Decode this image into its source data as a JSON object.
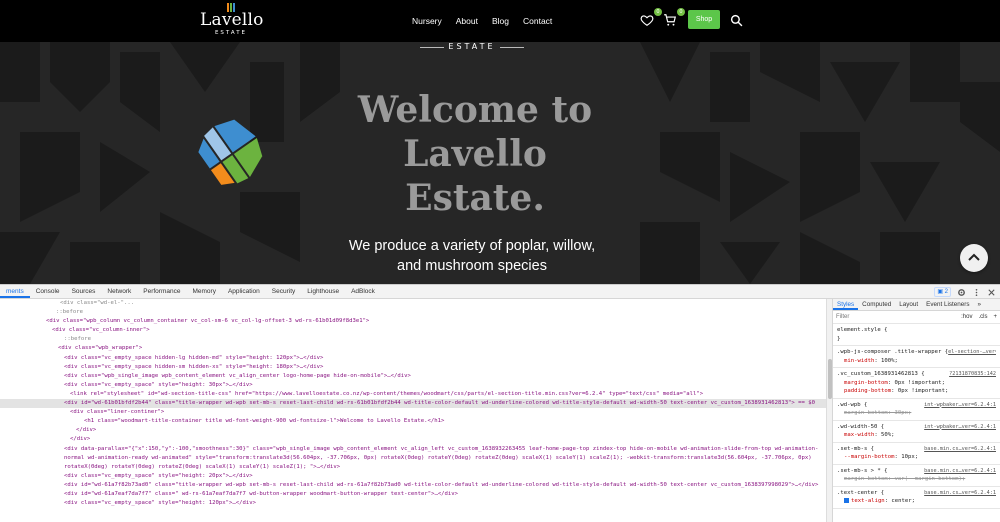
{
  "site": {
    "logo": {
      "name": "Lavello",
      "sub": "ESTATE"
    },
    "nav": [
      "Nursery",
      "About",
      "Blog",
      "Contact"
    ],
    "wishlist_count": "0",
    "cart_count": "0",
    "shop_label": "Shop",
    "estate_banner": "ESTATE",
    "hero_title": "Welcome to Lavello Estate.",
    "hero_subtitle": "We produce a variety of poplar, willow, and mushroom species",
    "colors": {
      "accent": "#5cc64a",
      "hero_title": "#9a9a9a",
      "background": "#262626"
    }
  },
  "devtools": {
    "tabs": [
      "ments",
      "Console",
      "Sources",
      "Network",
      "Performance",
      "Memory",
      "Application",
      "Security",
      "Lighthouse",
      "AdBlock"
    ],
    "active_tab": "ments",
    "issues_badge": "2",
    "elements": {
      "l0": "<div class=\"wd-el-\"...",
      "l1": "::before",
      "l2a": "<div class=\"wpb_column vc_column_container vc_col-sm-6 vc_col-lg-offset-3 wd-rs-61b01d09f8d3e1\">",
      "l3": "<div class=\"vc_column-inner\">",
      "l4": "::before",
      "l5": "<div class=\"wpb_wrapper\">",
      "l6": "<div class=\"vc_empty_space hidden-lg hidden-md\" style=\"height: 120px\">…</div>",
      "l7": "<div class=\"vc_empty_space hidden-sm hidden-xs\" style=\"height: 180px\">…</div>",
      "l8": "<div class=\"wpb_single_image wpb_content_element vc_align_center logo-home-page hide-on-mobile\">…</div>",
      "l9": "<div class=\"vc_empty_space\" style=\"height: 30px\">…</div>",
      "l10": "<link rel=\"stylesheet\" id=\"wd-section-title-css\" href=\"https://www.lavelloestate.co.nz/wp-content/themes/woodmart/css/parts/el-section-title.min.css?ver=6.2.4\" type=\"text/css\" media=\"all\">",
      "l11": "<div id=\"wd-61b01bfdf2b44\" class=\"title-wrapper wd-wpb set-mb-s reset-last-child  wd-rs-61b01bfdf2b44 wd-title-color-default wd-underline-colored wd-title-style-default wd-width-50 text-center vc_custom_1638931462813\"> == $0",
      "l12": "<div class=\"liner-continer\">",
      "l13": "<h1 class=\"woodmart-title-container title  wd-font-weight-900 wd-fontsize-l\">Welcome to Lavello Estate.</h1>",
      "l14": "</div>",
      "l15": "</div>",
      "l16": "<div data-parallax=\"{\"x\":150,\"y\":-100,\"smoothness\":30}\" class=\"wpb_single_image wpb_content_element vc_align_left vc_custom_1638932263455 leaf-home-page-top zindex-top hide-on-mobile wd-animation-slide-from-top wd-animation-normal wd-animation-ready wd-animated\" style=\"transform:translate3d(56.604px, -37.706px, 0px) rotateX(0deg) rotateY(0deg) rotateZ(0deg) scaleX(1) scaleY(1) scaleZ(1); -webkit-transform:translate3d(56.604px, -37.706px, 0px) rotateX(0deg) rotateY(0deg) rotateZ(0deg) scaleX(1) scaleY(1) scaleZ(1); \">…</div>",
      "l17": "<div class=\"vc_empty_space\" style=\"height: 20px\">…</div>",
      "l18": "<div id=\"wd-61a7f82b73ad0\" class=\"title-wrapper wd-wpb set-mb-s reset-last-child  wd-rs-61a7f82b73ad0 wd-title-color-default wd-underline-colored wd-title-style-default wd-width-50 text-center vc_custom_1638397998029\">…</div>",
      "l19": "<div id=\"wd-61a7eaf7da7f7\" class=\"  wd-rs-61a7eaf7da7f7 wd-button-wrapper woodmart-button-wrapper text-center\">…</div>",
      "l20": "<div class=\"vc_empty_space\" style=\"height: 120px\">…</div>"
    },
    "styles": {
      "tabs": [
        "Styles",
        "Computed",
        "Layout",
        "Event Listeners",
        "»"
      ],
      "filter_placeholder": "Filter",
      "hov": ":hov",
      "cls": ".cls",
      "plus": "+",
      "rules": [
        {
          "selector": "element.style {",
          "source": "",
          "props": []
        },
        {
          "selector": ".wpb-js-composer .title-wrapper {",
          "source": "el-section-…ver=6.2.4:1",
          "props": [
            {
              "n": "min-width",
              "v": "100%;",
              "strike": false
            }
          ]
        },
        {
          "selector": ".vc_custom_1638931462813 {",
          "source": "?2131870835:142",
          "props": [
            {
              "n": "margin-bottom",
              "v": "0px !important;",
              "strike": false
            },
            {
              "n": "padding-bottom",
              "v": "0px !important;",
              "strike": false
            }
          ]
        },
        {
          "selector": ".wd-wpb {",
          "source": "int-wpbaker…ver=6.2.4:1",
          "props": [
            {
              "n": "margin-bottom",
              "v": "30px;",
              "strike": true
            }
          ]
        },
        {
          "selector": ".wd-width-50 {",
          "source": "int-wpbaker…ver=6.2.4:1",
          "props": [
            {
              "n": "max-width",
              "v": "50%;",
              "strike": false
            }
          ]
        },
        {
          "selector": ".set-mb-s {",
          "source": "base.min.cs…ver=6.2.4:1",
          "props": [
            {
              "n": "--margin-bottom",
              "v": "10px;",
              "strike": false
            }
          ]
        },
        {
          "selector": ".set-mb-s > * {",
          "source": "base.min.cs…ver=6.2.4:1",
          "props": [
            {
              "n": "margin-bottom",
              "v": "var(--margin-bottom);",
              "strike": true
            }
          ]
        },
        {
          "selector": ".text-center {",
          "source": "base.min.cs…ver=6.2.4:1",
          "props": [
            {
              "n": "text-align",
              "v": "center;",
              "strike": false,
              "checked": true
            }
          ]
        }
      ]
    }
  }
}
